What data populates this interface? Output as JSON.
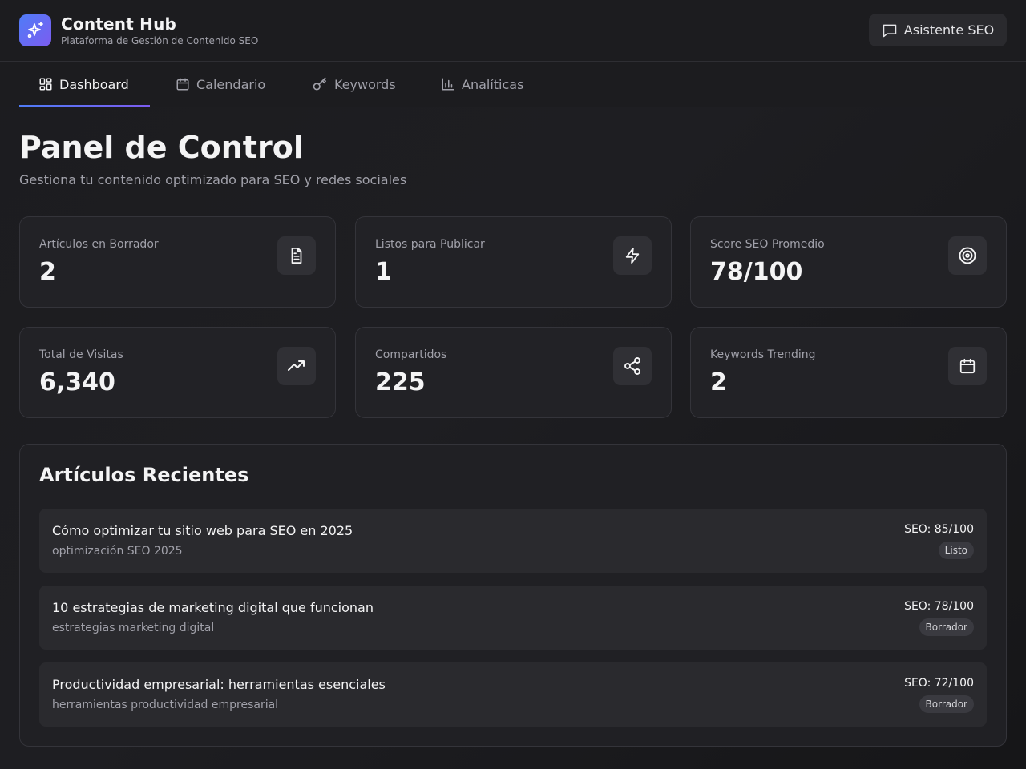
{
  "header": {
    "title": "Content Hub",
    "subtitle": "Plataforma de Gestión de Contenido SEO",
    "assistant_label": "Asistente SEO"
  },
  "nav": {
    "tabs": [
      {
        "label": "Dashboard",
        "icon": "dashboard-icon",
        "active": true
      },
      {
        "label": "Calendario",
        "icon": "calendar-icon",
        "active": false
      },
      {
        "label": "Keywords",
        "icon": "key-icon",
        "active": false
      },
      {
        "label": "Analíticas",
        "icon": "bar-chart-icon",
        "active": false
      }
    ]
  },
  "page": {
    "title": "Panel de Control",
    "subtitle": "Gestiona tu contenido optimizado para SEO y redes sociales"
  },
  "stats": [
    {
      "label": "Artículos en Borrador",
      "value": "2",
      "icon": "document-icon"
    },
    {
      "label": "Listos para Publicar",
      "value": "1",
      "icon": "lightning-icon"
    },
    {
      "label": "Score SEO Promedio",
      "value": "78/100",
      "icon": "target-icon"
    },
    {
      "label": "Total de Visitas",
      "value": "6,340",
      "icon": "trending-up-icon"
    },
    {
      "label": "Compartidos",
      "value": "225",
      "icon": "share-icon"
    },
    {
      "label": "Keywords Trending",
      "value": "2",
      "icon": "calendar-icon"
    }
  ],
  "recent": {
    "title": "Artículos Recientes",
    "articles": [
      {
        "title": "Cómo optimizar tu sitio web para SEO en 2025",
        "keywords": "optimización SEO 2025",
        "seo": "SEO: 85/100",
        "status": "Listo"
      },
      {
        "title": "10 estrategias de marketing digital que funcionan",
        "keywords": "estrategias marketing digital",
        "seo": "SEO: 78/100",
        "status": "Borrador"
      },
      {
        "title": "Productividad empresarial: herramientas esenciales",
        "keywords": "herramientas productividad empresarial",
        "seo": "SEO: 72/100",
        "status": "Borrador"
      }
    ]
  },
  "colors": {
    "accent_start": "#4f7cf7",
    "accent_end": "#7c5cf0",
    "background": "#18181b",
    "card": "#222226"
  }
}
